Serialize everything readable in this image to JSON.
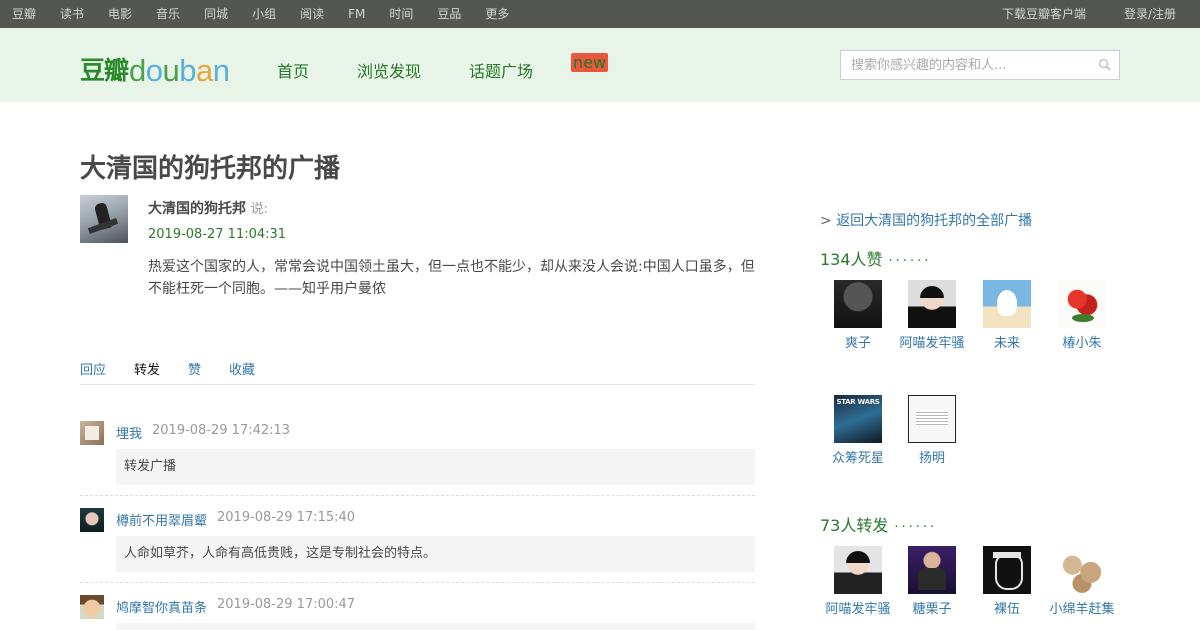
{
  "topnav": {
    "links": [
      "豆瓣",
      "读书",
      "电影",
      "音乐",
      "同城",
      "小组",
      "阅读",
      "FM",
      "时间",
      "豆品",
      "更多"
    ],
    "download": "下载豆瓣客户端",
    "login": "登录/注册"
  },
  "header": {
    "logo_cn": "豆瓣",
    "logo_en": [
      "d",
      "o",
      "u",
      "b",
      "a",
      "n"
    ],
    "nav": [
      "首页",
      "浏览发现",
      "话题广场"
    ],
    "new_badge": "new",
    "search_placeholder": "搜索你感兴趣的内容和人..."
  },
  "page": {
    "title": "大清国的狗托邦的广播",
    "author": "大清国的狗托邦",
    "says": "说:",
    "time": "2019-08-27 11:04:31",
    "text": "热爱这个国家的人，常常会说中国领土虽大，但一点也不能少，却从来没人会说:中国人口虽多，但不能枉死一个同胞。——知乎用户曼侬"
  },
  "tabs": [
    "回应",
    "转发",
    "赞",
    "收藏"
  ],
  "active_tab": "转发",
  "reshares": [
    {
      "user": "埋我",
      "time": "2019-08-29 17:42:13",
      "comment": "转发广播"
    },
    {
      "user": "樽前不用翠眉颦",
      "time": "2019-08-29 17:15:40",
      "comment": "人命如草芥，人命有高低贵贱，这是专制社会的特点。"
    },
    {
      "user": "鸠摩智你真苗条",
      "time": "2019-08-29 17:00:47",
      "comment": ""
    }
  ],
  "sidebar": {
    "back_prefix": ">",
    "back_link": "返回大清国的狗托邦的全部广播",
    "likes_title": "134人赞",
    "likes_dots": "······",
    "likers": [
      "爽子",
      "阿喵发牢骚",
      "未来",
      "椿小朱",
      "众筹死星",
      "扬明"
    ],
    "reshares_title": "73人转发",
    "reshares_dots": "······",
    "resharers": [
      "阿喵发牢骚",
      "糖栗子",
      "裸伍",
      "小绵羊赶集"
    ]
  },
  "colors": {
    "topnav_bg": "#545652",
    "header_bg": "#e9f4e9",
    "nav_green": "#267726",
    "link_blue": "#3377aa",
    "section_green": "#2a7a2a"
  },
  "icons": {
    "search": "search-icon"
  }
}
